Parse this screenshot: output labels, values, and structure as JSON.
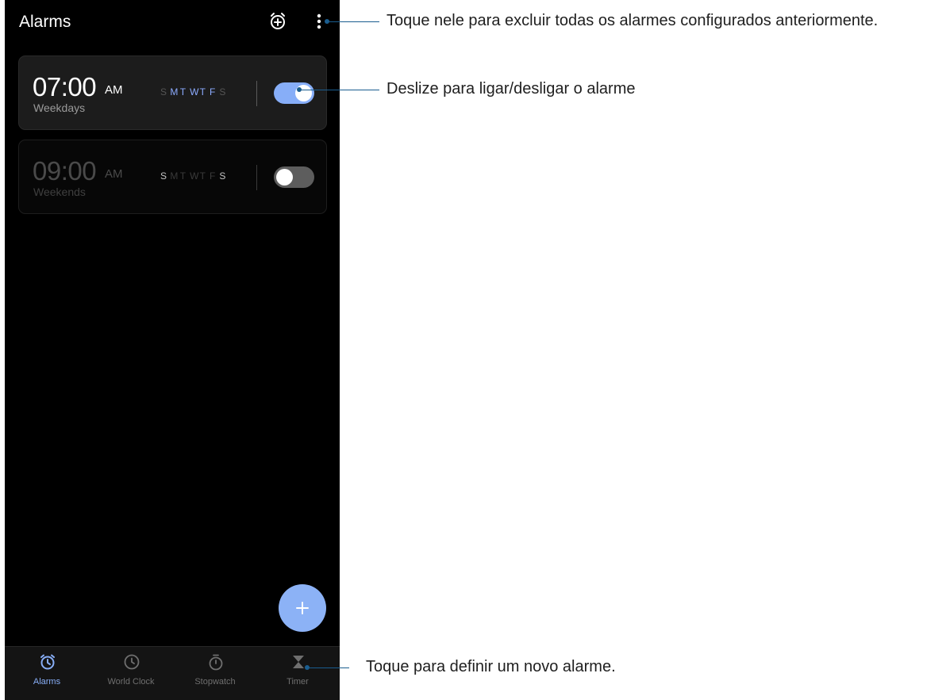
{
  "app": {
    "title": "Alarms"
  },
  "toolbar": {
    "add_alarm_icon": "alarm-add-icon",
    "more_icon": "more-vert-icon"
  },
  "alarms": [
    {
      "time": "07:00",
      "ampm": "AM",
      "repeat": "Weekdays",
      "days": [
        "S",
        "M",
        "T",
        "W",
        "T",
        "F",
        "S"
      ],
      "days_active": [
        false,
        true,
        true,
        true,
        true,
        true,
        false
      ],
      "enabled": true
    },
    {
      "time": "09:00",
      "ampm": "AM",
      "repeat": "Weekends",
      "days": [
        "S",
        "M",
        "T",
        "W",
        "T",
        "F",
        "S"
      ],
      "days_active": [
        true,
        false,
        false,
        false,
        false,
        false,
        true
      ],
      "enabled": false
    }
  ],
  "fab": {
    "icon": "plus-icon"
  },
  "bottom_nav": [
    {
      "label": "Alarms",
      "icon": "alarm-clock-icon",
      "active": true
    },
    {
      "label": "World Clock",
      "icon": "clock-icon",
      "active": false
    },
    {
      "label": "Stopwatch",
      "icon": "stopwatch-icon",
      "active": false
    },
    {
      "label": "Timer",
      "icon": "hourglass-icon",
      "active": false
    }
  ],
  "callouts": {
    "more": "Toque nele para excluir todas os alarmes configurados anteriormente.",
    "toggle": "Deslize para ligar/desligar o alarme",
    "timer": "Toque para definir um novo alarme."
  },
  "colors": {
    "accent": "#87aef8",
    "callout": "#1a5d8f",
    "background": "#000000"
  }
}
